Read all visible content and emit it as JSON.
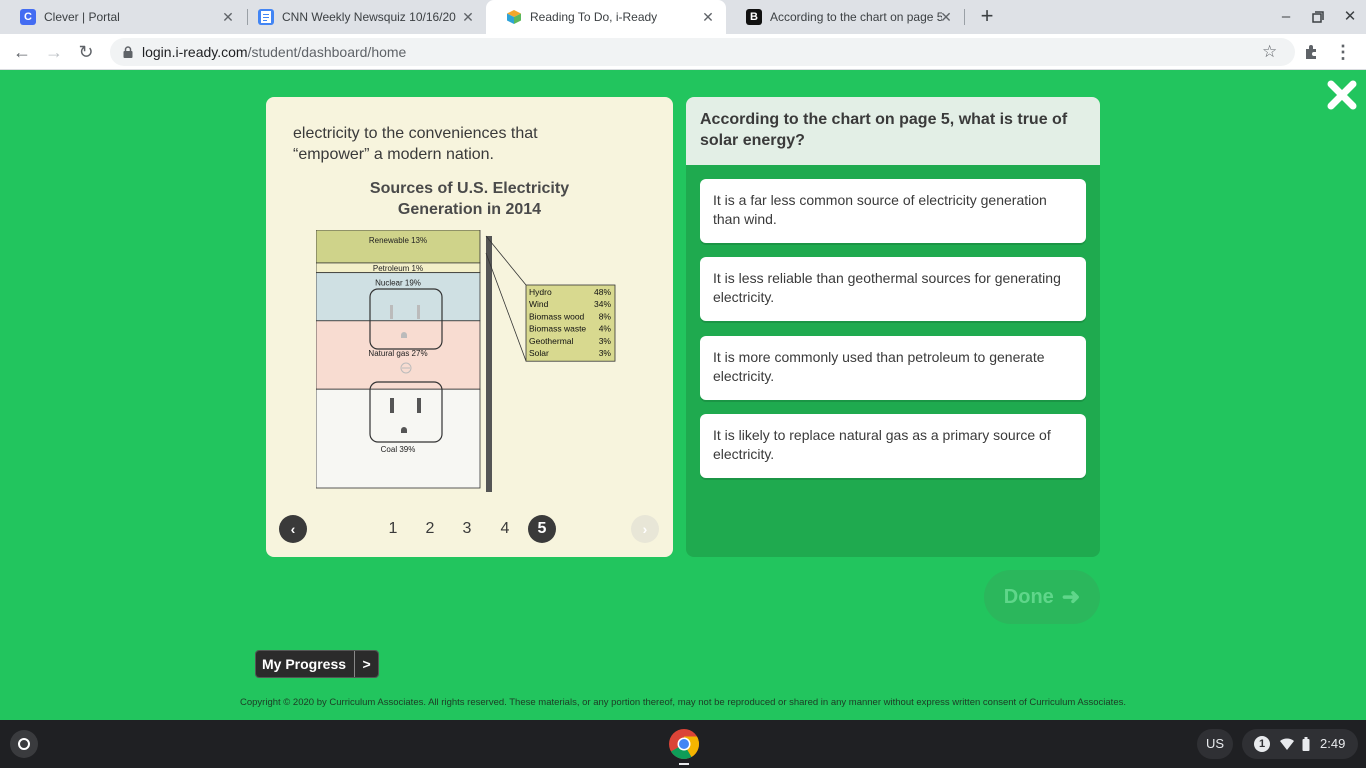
{
  "browser": {
    "tabs": [
      {
        "title": "Clever | Portal",
        "favicon_color": "#436cf2",
        "favicon_glyph": "C"
      },
      {
        "title": "CNN Weekly Newsquiz 10/16/20",
        "favicon_color": "#4285f4",
        "favicon_glyph": ""
      },
      {
        "title": "Reading To Do, i-Ready",
        "favicon_color": "#f4a62a",
        "favicon_glyph": ""
      },
      {
        "title": "According to the chart on page 5",
        "favicon_color": "#111111",
        "favicon_glyph": "B"
      }
    ],
    "url_host": "login.i-ready.com",
    "url_path": "/student/dashboard/home"
  },
  "passage": {
    "text_line1": "electricity to the conveniences that",
    "text_line2": "“empower” a modern nation.",
    "chart_title_line1": "Sources of U.S. Electricity",
    "chart_title_line2": "Generation in 2014"
  },
  "chart_data": {
    "type": "bar",
    "title": "Sources of U.S. Electricity Generation in 2014",
    "main": [
      {
        "label": "Renewable",
        "value": 13,
        "display": "Renewable 13%",
        "color": "#cfd38a"
      },
      {
        "label": "Petroleum",
        "value": 1,
        "display": "Petroleum 1%",
        "color": "#f3efc9"
      },
      {
        "label": "Nuclear",
        "value": 19,
        "display": "Nuclear 19%",
        "color": "#cfe0e3"
      },
      {
        "label": "Natural gas",
        "value": 27,
        "display": "Natural gas 27%",
        "color": "#f8dcd1"
      },
      {
        "label": "Coal",
        "value": 39,
        "display": "Coal 39%",
        "color": "#f7f7f3"
      }
    ],
    "renewable_breakdown": [
      {
        "label": "Hydro",
        "value": "48%"
      },
      {
        "label": "Wind",
        "value": "34%"
      },
      {
        "label": "Biomass wood",
        "value": "8%"
      },
      {
        "label": "Biomass waste",
        "value": "4%"
      },
      {
        "label": "Geothermal",
        "value": "3%"
      },
      {
        "label": "Solar",
        "value": "3%"
      }
    ],
    "breakdown_color": "#d8d98f"
  },
  "pager": {
    "prev_glyph": "‹",
    "next_glyph": "›",
    "pages": [
      "1",
      "2",
      "3",
      "4",
      "5"
    ],
    "current": "5"
  },
  "question": {
    "prompt": "According to the chart on page 5, what is true of solar energy?",
    "answers": [
      "It is a far less common source of electricity generation than wind.",
      "It is less reliable than geothermal sources for generating electricity.",
      "It is more commonly used than petroleum to generate electricity.",
      "It is likely to replace natural gas as a primary source of electricity."
    ]
  },
  "done_label": "Done",
  "my_progress": {
    "label": "My Progress",
    "arrow": ">"
  },
  "copyright": "Copyright © 2020 by Curriculum Associates. All rights reserved. These materials, or any portion thereof, may not be reproduced or shared in any manner without express written consent of Curriculum Associates.",
  "shelf": {
    "ime": "US",
    "notification_count": "1",
    "time": "2:49"
  },
  "colors": {
    "app_background": "#22c55e",
    "question_panel": "#1faa4f",
    "passage_panel": "#f7f4dd"
  }
}
